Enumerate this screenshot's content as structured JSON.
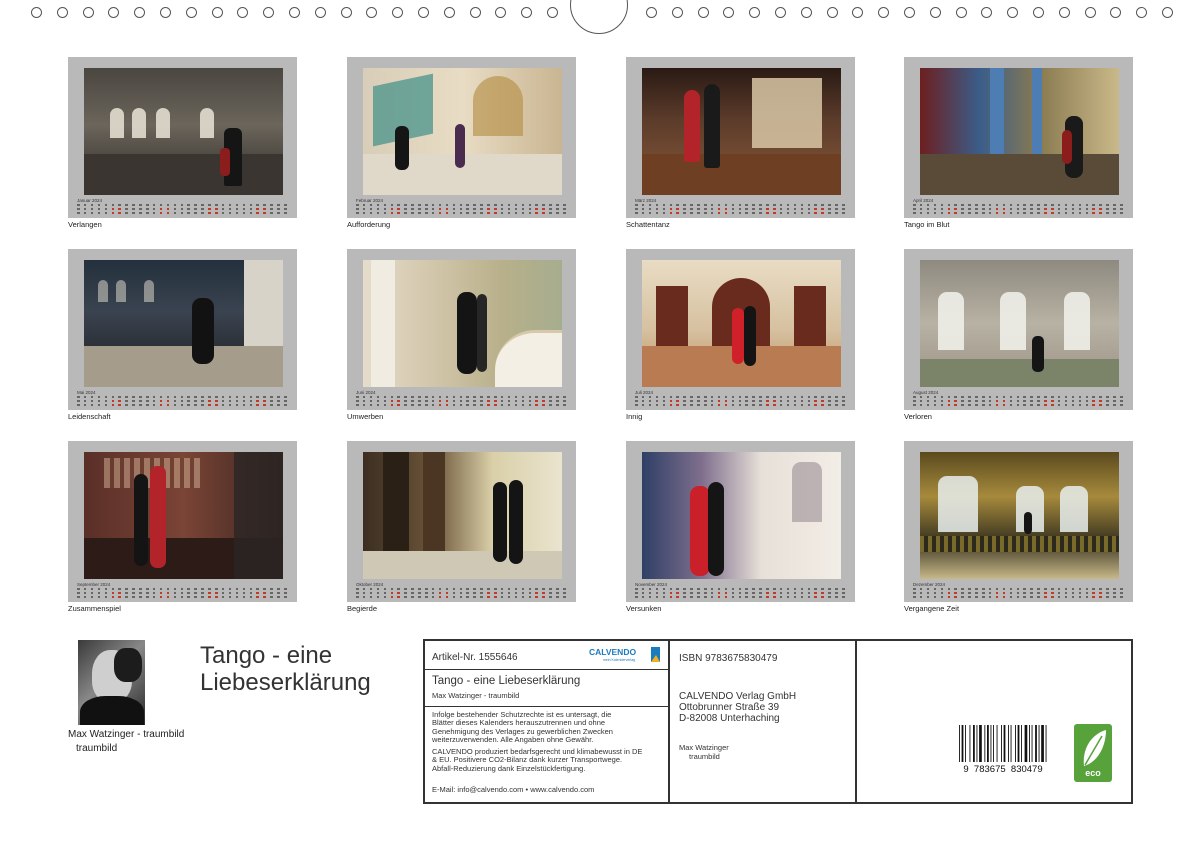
{
  "months": [
    {
      "key": "jan",
      "label": "Januar 2024",
      "title": "Verlangen"
    },
    {
      "key": "feb",
      "label": "Februar 2024",
      "title": "Aufforderung"
    },
    {
      "key": "mar",
      "label": "März 2024",
      "title": "Schattentanz"
    },
    {
      "key": "apr",
      "label": "April 2024",
      "title": "Tango im Blut"
    },
    {
      "key": "may",
      "label": "Mai 2024",
      "title": "Leidenschaft"
    },
    {
      "key": "jun",
      "label": "Juni 2024",
      "title": "Umwerben"
    },
    {
      "key": "jul",
      "label": "Juli 2024",
      "title": "Innig"
    },
    {
      "key": "aug",
      "label": "August 2024",
      "title": "Verloren"
    },
    {
      "key": "sep",
      "label": "September 2024",
      "title": "Zusammenspiel"
    },
    {
      "key": "oct",
      "label": "Oktober 2024",
      "title": "Begierde"
    },
    {
      "key": "nov",
      "label": "November 2024",
      "title": "Versunken"
    },
    {
      "key": "dec",
      "label": "Dezember 2024",
      "title": "Vergangene Zeit"
    }
  ],
  "author": {
    "name": "Max Watzinger - traumbild",
    "sub": "traumbild"
  },
  "calendar_title": {
    "line1": "Tango - eine",
    "line2": "Liebeserklärung"
  },
  "product": {
    "article": "Artikel-Nr. 1555646",
    "logo": "CALVENDO",
    "logo_tagline": "mein Kalenderverlag",
    "title": "Tango - eine Liebeserklärung",
    "author_line": "Max Watzinger - traumbild",
    "legal1": [
      "Infolge bestehender Schutzrechte ist es untersagt, die",
      "Blätter dieses Kalenders herauszutrennen und ohne",
      "Genehmigung des Verlages zu gewerblichen Zwecken",
      "weiterzuverwenden. Alle Angaben ohne Gewähr."
    ],
    "legal2": [
      "CALVENDO produziert bedarfsgerecht und klimabewusst in DE",
      "& EU. Positivere CO2-Bilanz dank kurzer Transportwege.",
      "Abfall-Reduzierung dank Einzelstückfertigung."
    ],
    "contact": "E-Mail: info@calvendo.com • www.calvendo.com"
  },
  "publisher": {
    "isbn": "ISBN 9783675830479",
    "addr": [
      "CALVENDO Verlag GmbH",
      "Ottobrunner Straße 39",
      "D-82008 Unterhaching"
    ],
    "author": "Max Watzinger",
    "author_sub": "traumbild"
  },
  "barcode": {
    "digits": "9  783675  830479"
  },
  "eco_label": "eco",
  "colors": {
    "tile_bg": "#b9b9b9",
    "weekend_red": "#c0392b",
    "eco_green": "#57a23a",
    "calvendo_blue": "#1a7bbf"
  }
}
